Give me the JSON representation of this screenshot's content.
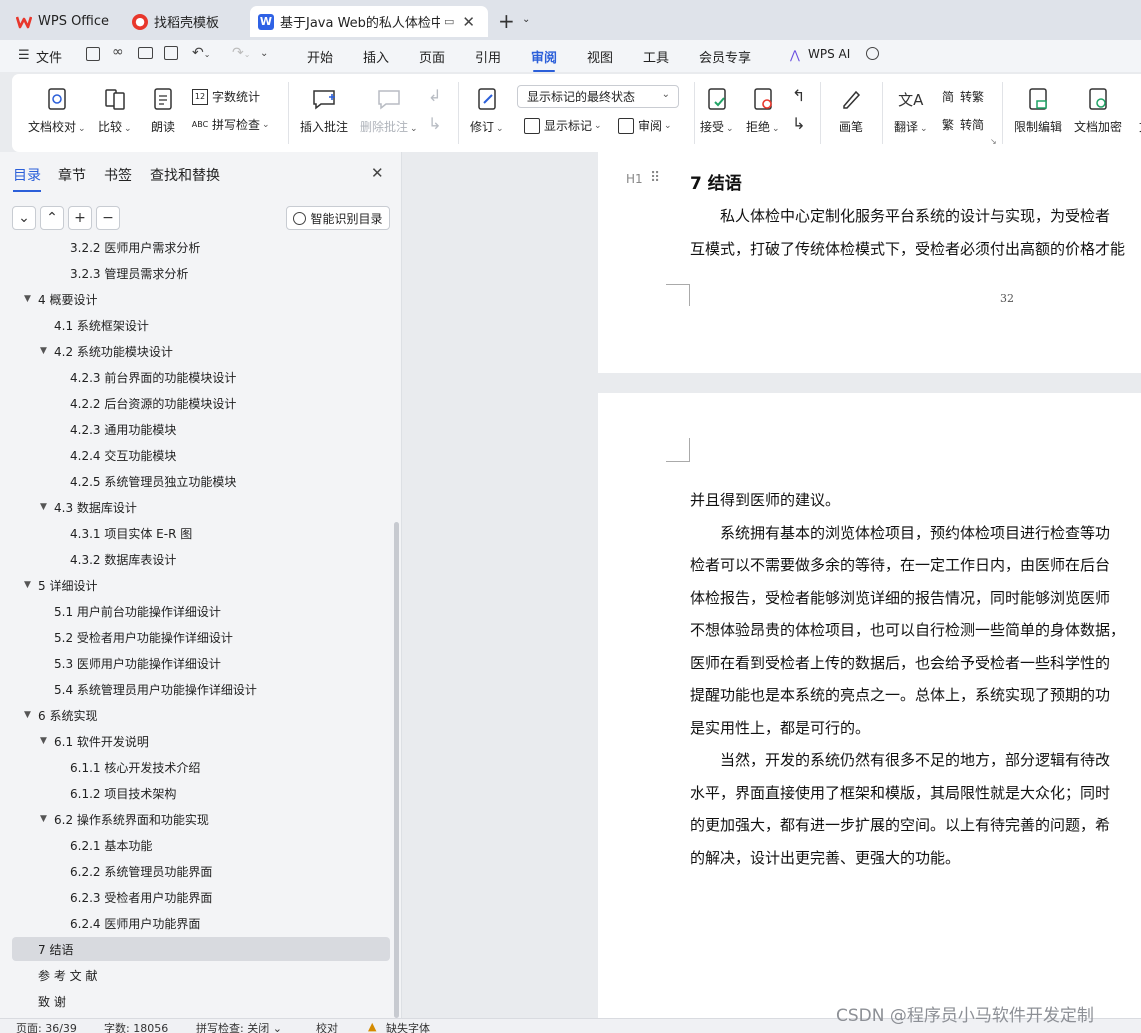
{
  "tabs": [
    {
      "label": "WPS Office"
    },
    {
      "label": "找稻壳模板"
    },
    {
      "label": "基于Java Web的私人体检中心"
    }
  ],
  "menu": {
    "file": "文件",
    "items": [
      "开始",
      "插入",
      "页面",
      "引用",
      "审阅",
      "视图",
      "工具",
      "会员专享"
    ],
    "active": "审阅",
    "ai": "WPS AI"
  },
  "ribbon": {
    "doc_check": "文档校对",
    "compare": "比较",
    "read_aloud": "朗读",
    "word_count": "字数统计",
    "spell_check": "拼写检查",
    "insert_comment": "插入批注",
    "delete_comment": "删除批注",
    "revise": "修订",
    "display_state": "显示标记的最终状态",
    "show_markup": "显示标记",
    "review": "审阅",
    "accept": "接受",
    "reject": "拒绝",
    "pen": "画笔",
    "translate": "翻译",
    "to_traditional": "转繁",
    "to_simplified": "转简",
    "restrict_edit": "限制编辑",
    "doc_encrypt": "文档加密",
    "more": "文"
  },
  "sidebar": {
    "tabs": [
      "目录",
      "章节",
      "书签",
      "查找和替换"
    ],
    "smart_toc": "智能识别目录",
    "toc": [
      {
        "label": "3.2.2  医师用户需求分析",
        "level": 3
      },
      {
        "label": "3.2.3  管理员需求分析",
        "level": 3
      },
      {
        "label": "4  概要设计",
        "level": 1,
        "exp": true
      },
      {
        "label": "4.1  系统框架设计",
        "level": 2
      },
      {
        "label": "4.2  系统功能模块设计",
        "level": 2,
        "exp": true
      },
      {
        "label": "4.2.3 前台界面的功能模块设计",
        "level": 3
      },
      {
        "label": "4.2.2  后台资源的功能模块设计",
        "level": 3
      },
      {
        "label": "4.2.3  通用功能模块",
        "level": 3
      },
      {
        "label": "4.2.4  交互功能模块",
        "level": 3
      },
      {
        "label": "4.2.5  系统管理员独立功能模块",
        "level": 3
      },
      {
        "label": "4.3  数据库设计",
        "level": 2,
        "exp": true
      },
      {
        "label": "4.3.1  项目实体 E-R 图",
        "level": 3
      },
      {
        "label": "4.3.2  数据库表设计",
        "level": 3
      },
      {
        "label": "5  详细设计",
        "level": 1,
        "exp": true
      },
      {
        "label": "5.1 用户前台功能操作详细设计",
        "level": 2
      },
      {
        "label": "5.2 受检者用户功能操作详细设计",
        "level": 2
      },
      {
        "label": "5.3  医师用户功能操作详细设计",
        "level": 2
      },
      {
        "label": "5.4  系统管理员用户功能操作详细设计",
        "level": 2
      },
      {
        "label": "6  系统实现",
        "level": 1,
        "exp": true
      },
      {
        "label": "6.1  软件开发说明",
        "level": 2,
        "exp": true
      },
      {
        "label": "6.1.1  核心开发技术介绍",
        "level": 3
      },
      {
        "label": "6.1.2  项目技术架构",
        "level": 3
      },
      {
        "label": "6.2  操作系统界面和功能实现",
        "level": 2,
        "exp": true
      },
      {
        "label": "6.2.1  基本功能",
        "level": 3
      },
      {
        "label": "6.2.2  系统管理员功能界面",
        "level": 3
      },
      {
        "label": "6.2.3  受检者用户功能界面",
        "level": 3
      },
      {
        "label": "6.2.4  医师用户功能界面",
        "level": 3
      },
      {
        "label": "7  结语",
        "level": 1,
        "selected": true
      },
      {
        "label": "参 考 文 献",
        "level": 1
      },
      {
        "label": "致      谢",
        "level": 1
      }
    ]
  },
  "document": {
    "heading_marker": "H1",
    "heading": "7  结语",
    "page1_lines": [
      "私人体检中心定制化服务平台系统的设计与实现，为受检者",
      "互模式，打破了传统体检模式下，受检者必须付出高额的价格才能"
    ],
    "page_number": "32",
    "page2_lines": [
      "并且得到医师的建议。",
      "系统拥有基本的浏览体检项目，预约体检项目进行检查等功",
      "检者可以不需要做多余的等待，在一定工作日内，由医师在后台",
      "体检报告，受检者能够浏览详细的报告情况，同时能够浏览医师",
      "不想体验昂贵的体检项目，也可以自行检测一些简单的身体数据，",
      "医师在看到受检者上传的数据后，也会给予受检者一些科学性的",
      "提醒功能也是本系统的亮点之一。总体上，系统实现了预期的功",
      "是实用性上，都是可行的。",
      "当然，开发的系统仍然有很多不足的地方，部分逻辑有待改",
      "水平，界面直接使用了框架和模版，其局限性就是大众化；同时",
      "的更加强大，都有进一步扩展的空间。以上有待完善的问题，希",
      "的解决，设计出更完善、更强大的功能。"
    ],
    "page2_indent": [
      false,
      true,
      false,
      false,
      false,
      false,
      false,
      false,
      true,
      false,
      false,
      false
    ]
  },
  "status": {
    "page": "页面: 36/39",
    "words": "字数: 18056",
    "spell": "拼写检查: 关闭",
    "proof": "校对",
    "missing_font": "缺失字体"
  },
  "watermark": "CSDN @程序员小马软件开发定制",
  "colors": {
    "accent": "#2b5fd9",
    "wps_red": "#e8372c",
    "doc_blue": "#2f62e5"
  }
}
